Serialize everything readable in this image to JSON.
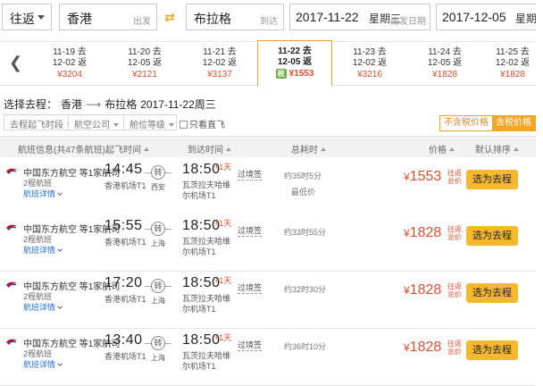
{
  "search": {
    "trip_type": "往返",
    "from_city": "香港",
    "from_label": "出发",
    "to_city": "布拉格",
    "to_label": "到达",
    "depart_date": "2017-11-22",
    "depart_weekday": "星期三",
    "depart_label": "出发日期",
    "return_date": "2017-12-05",
    "return_weekday": "星期二"
  },
  "dates": [
    {
      "go": "11-19 去",
      "ret": "12-02 返",
      "price": "¥3204"
    },
    {
      "go": "11-20 去",
      "ret": "12-05 返",
      "price": "¥2121"
    },
    {
      "go": "11-21 去",
      "ret": "12-02 返",
      "price": "¥3137"
    },
    {
      "go": "11-22 去",
      "ret": "12-05 返",
      "price": "¥1553",
      "tag": "税",
      "selected": true
    },
    {
      "go": "11-23 去",
      "ret": "12-02 返",
      "price": "¥3216"
    },
    {
      "go": "11-24 去",
      "ret": "12-05 返",
      "price": "¥1828"
    },
    {
      "go": "11-25 去",
      "ret": "12-02 返",
      "price": "¥1828"
    }
  ],
  "route": {
    "prefix": "选择去程：",
    "from": "香港",
    "arrow": "⟶",
    "to": "布拉格",
    "date": "2017-11-22周三"
  },
  "filters": {
    "depart_time": "去程起飞时段",
    "airline": "航空公司",
    "cabin": "舱位等级",
    "direct_only": "只看直飞",
    "excl_tax": "不含税价格",
    "incl_tax": "含税价格"
  },
  "columns": {
    "info": "航班信息",
    "count": "(共47条航班)",
    "depart": "起飞时间",
    "arrive": "到达时间",
    "duration": "总耗时",
    "price": "价格",
    "sort": "默认排序"
  },
  "flights": [
    {
      "airline": "中国东方航空 等1家航司",
      "segments": "2程航班",
      "detail": "航班详情",
      "dep_time": "14:45",
      "dep_airport": "香港机场T1",
      "transit": "转",
      "via": "西安",
      "arr_time": "18:50",
      "plus": "+1天",
      "arr_airport": "瓦茨拉夫哈维尔机场T1",
      "visa": "过境签",
      "duration": "约35时5分",
      "note": "最低价",
      "currency": "¥",
      "price": "1553",
      "price_type": "往返总价",
      "button": "选为去程"
    },
    {
      "airline": "中国东方航空 等1家航司",
      "segments": "2程航班",
      "detail": "航班详情",
      "dep_time": "15:55",
      "dep_airport": "香港机场T1",
      "transit": "转",
      "via": "上海",
      "arr_time": "18:50",
      "plus": "+1天",
      "arr_airport": "瓦茨拉夫哈维尔机场T1",
      "visa": "过境签",
      "duration": "约33时55分",
      "note": "",
      "currency": "¥",
      "price": "1828",
      "price_type": "往返总价",
      "button": "选为去程"
    },
    {
      "airline": "中国东方航空 等1家航司",
      "segments": "2程航班",
      "detail": "航班详情",
      "dep_time": "17:20",
      "dep_airport": "香港机场T1",
      "transit": "转",
      "via": "上海",
      "arr_time": "18:50",
      "plus": "+1天",
      "arr_airport": "瓦茨拉夫哈维尔机场T1",
      "visa": "过境签",
      "duration": "约32时30分",
      "note": "",
      "currency": "¥",
      "price": "1828",
      "price_type": "往返总价",
      "button": "选为去程"
    },
    {
      "airline": "中国东方航空 等1家航司",
      "segments": "2程航班",
      "detail": "航班详情",
      "dep_time": "13:40",
      "dep_airport": "香港机场T1",
      "transit": "转",
      "via": "上海",
      "arr_time": "18:50",
      "plus": "+1天",
      "arr_airport": "瓦茨拉夫哈维尔机场T1",
      "visa": "过境签",
      "duration": "约36时10分",
      "note": "",
      "currency": "¥",
      "price": "1828",
      "price_type": "往返总价",
      "button": "选为去程"
    }
  ],
  "colors": {
    "accent": "#f5a623",
    "price": "#e64c2e",
    "link": "#1e6fd2",
    "button": "#f5b82e"
  }
}
